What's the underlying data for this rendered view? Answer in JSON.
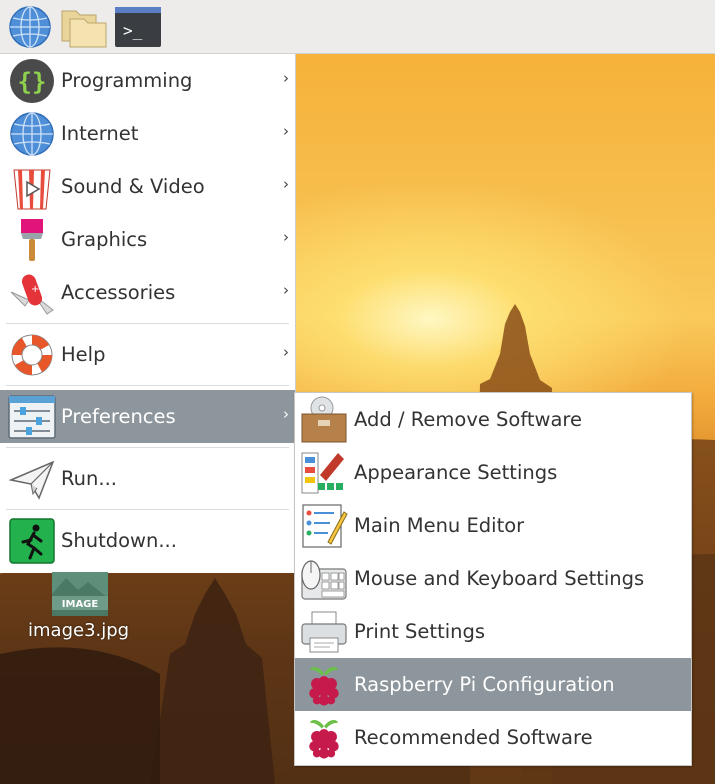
{
  "panel": {
    "buttons": [
      {
        "name": "menu",
        "icon": "raspberry-icon"
      },
      {
        "name": "browser",
        "icon": "globe-icon"
      },
      {
        "name": "file-manager",
        "icon": "folder-icon"
      },
      {
        "name": "terminal",
        "icon": "terminal-icon",
        "label": ">_"
      }
    ]
  },
  "menu": {
    "items": [
      {
        "label": "Programming",
        "icon": "programming-icon"
      },
      {
        "label": "Internet",
        "icon": "globe-icon"
      },
      {
        "label": "Sound & Video",
        "icon": "popcorn-icon"
      },
      {
        "label": "Graphics",
        "icon": "paintbrush-icon"
      },
      {
        "label": "Accessories",
        "icon": "pocket-knife-icon"
      },
      {
        "label": "Help",
        "icon": "lifebuoy-icon"
      },
      {
        "label": "Preferences",
        "icon": "sliders-icon",
        "active": true
      },
      {
        "label": "Run...",
        "icon": "paper-plane-icon"
      },
      {
        "label": "Shutdown...",
        "icon": "exit-icon"
      }
    ],
    "arrow": "›"
  },
  "submenu": {
    "items": [
      {
        "label": "Add / Remove Software",
        "icon": "package-icon"
      },
      {
        "label": "Appearance Settings",
        "icon": "appearance-icon"
      },
      {
        "label": "Main Menu Editor",
        "icon": "menu-editor-icon"
      },
      {
        "label": "Mouse and Keyboard Settings",
        "icon": "mouse-keyboard-icon"
      },
      {
        "label": "Print Settings",
        "icon": "printer-icon"
      },
      {
        "label": "Raspberry Pi Configuration",
        "icon": "raspberry-icon",
        "active": true
      },
      {
        "label": "Recommended Software",
        "icon": "raspberry-icon"
      }
    ]
  },
  "desktop": {
    "file": {
      "name": "image3.jpg",
      "badge": "IMAGE"
    }
  },
  "colors": {
    "highlight": "#8d969c",
    "panel": "#edeceb",
    "raspberry": "#c51a4a",
    "leaf": "#6cc04a"
  }
}
